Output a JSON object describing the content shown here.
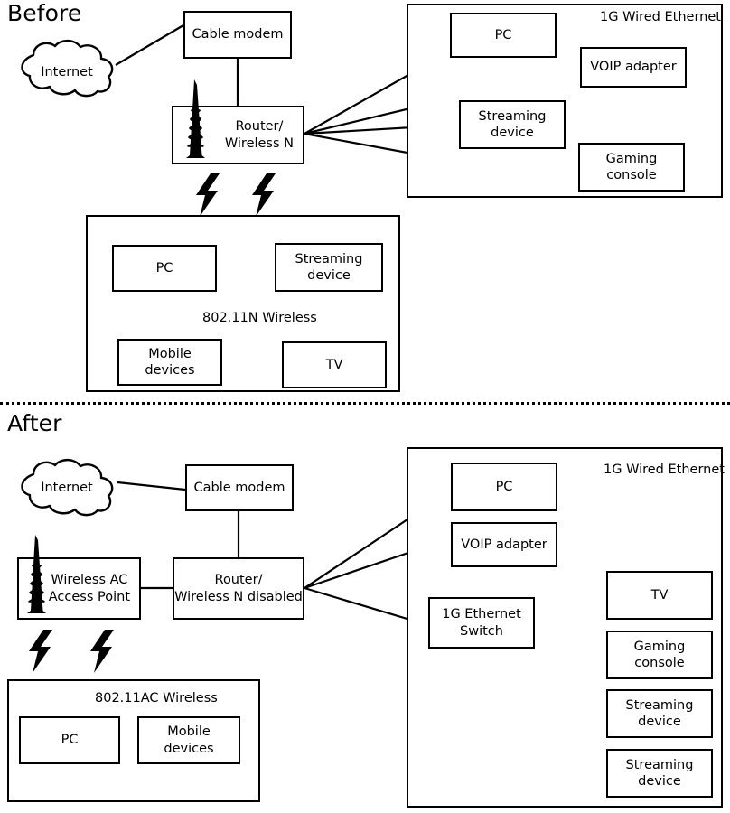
{
  "diagram": {
    "title_before": "Before",
    "title_after": "After"
  },
  "before": {
    "heading": "Before",
    "internet": {
      "label": "Internet",
      "icon": "cloud-icon"
    },
    "cable_modem": {
      "label": "Cable modem"
    },
    "router": {
      "label": "Router/\nWireless N",
      "line1": "Router/",
      "line2": "Wireless N",
      "icon": "antenna-tower-icon"
    },
    "wired_group": {
      "label": "1G Wired Ethernet",
      "devices": [
        {
          "label": "PC"
        },
        {
          "label": "VOIP adapter"
        },
        {
          "label": "Streaming device",
          "line1": "Streaming",
          "line2": "device"
        },
        {
          "label": "Gaming console",
          "line1": "Gaming",
          "line2": "console"
        }
      ]
    },
    "wireless_group": {
      "label": "802.11N Wireless",
      "devices": [
        {
          "label": "PC"
        },
        {
          "label": "Streaming device",
          "line1": "Streaming",
          "line2": "device"
        },
        {
          "label": "Mobile devices",
          "line1": "Mobile",
          "line2": "devices"
        },
        {
          "label": "TV"
        }
      ]
    },
    "bolts": [
      {
        "name": "wireless-signal-bolt-1"
      },
      {
        "name": "wireless-signal-bolt-2"
      }
    ]
  },
  "after": {
    "heading": "After",
    "internet": {
      "label": "Internet",
      "icon": "cloud-icon"
    },
    "cable_modem": {
      "label": "Cable modem"
    },
    "router": {
      "label": "Router/\nWireless N disabled",
      "line1": "Router/",
      "line2": "Wireless N disabled"
    },
    "access_point": {
      "label": "Wireless AC\nAccess Point",
      "line1": "Wireless AC",
      "line2": "Access Point",
      "icon": "antenna-tower-icon"
    },
    "wired_group": {
      "label": "1G Wired Ethernet",
      "devices": [
        {
          "label": "PC"
        },
        {
          "label": "VOIP adapter"
        },
        {
          "label": "1G Ethernet Switch",
          "line1": "1G Ethernet",
          "line2": "Switch"
        },
        {
          "label": "TV"
        },
        {
          "label": "Gaming console",
          "line1": "Gaming",
          "line2": "console"
        },
        {
          "label": "Streaming device",
          "line1": "Streaming",
          "line2": "device"
        },
        {
          "label": "Streaming device",
          "line1": "Streaming",
          "line2": "device"
        }
      ]
    },
    "wireless_group": {
      "label": "802.11AC Wireless",
      "devices": [
        {
          "label": "PC"
        },
        {
          "label": "Mobile devices",
          "line1": "Mobile",
          "line2": "devices"
        }
      ]
    },
    "bolts": [
      {
        "name": "wireless-signal-bolt-1"
      },
      {
        "name": "wireless-signal-bolt-2"
      }
    ]
  },
  "colors": {
    "stroke": "#000000",
    "fill": "#ffffff"
  }
}
